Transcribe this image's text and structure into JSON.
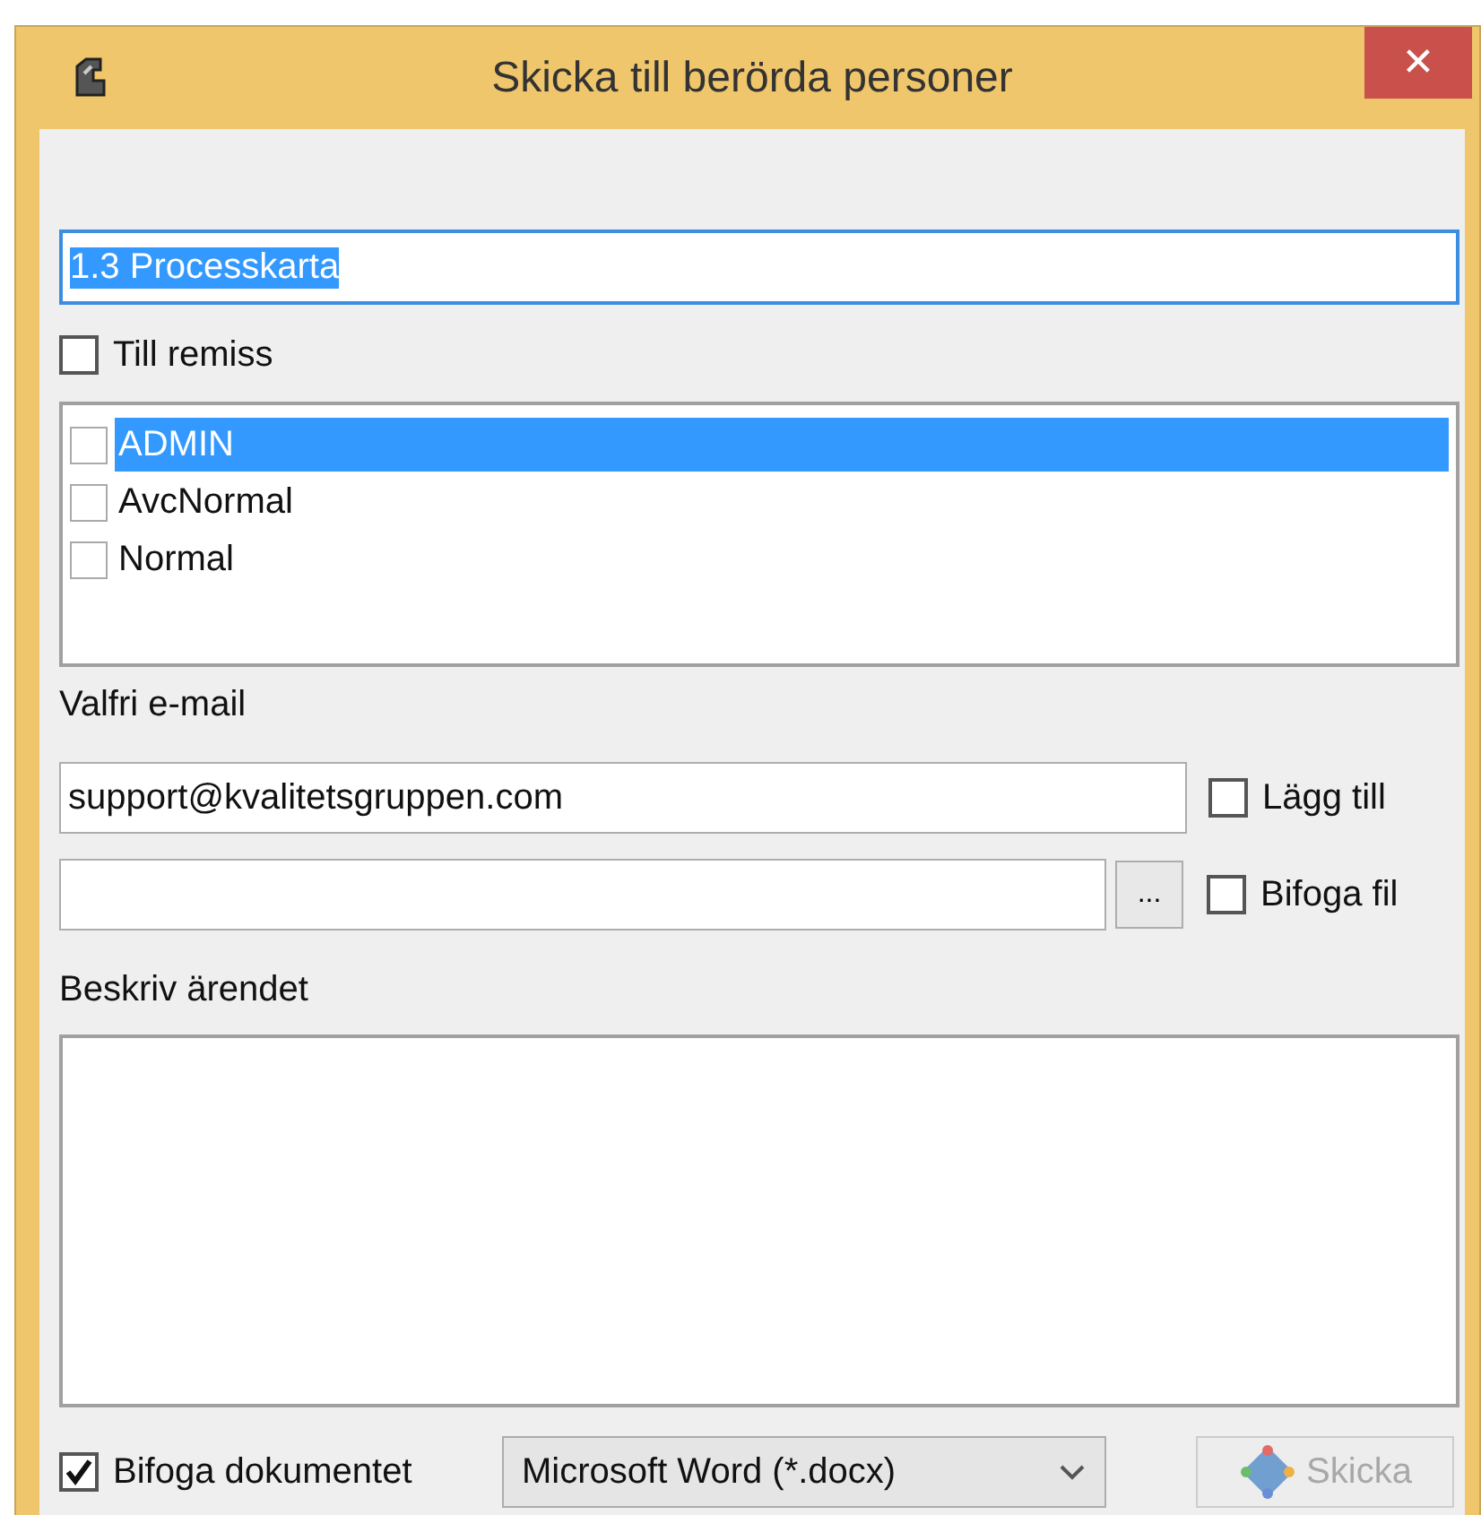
{
  "window": {
    "title": "Skicka till berörda personer",
    "close_label": "✕"
  },
  "subject_field": {
    "value": "1.3 Processkarta",
    "text_selected": true
  },
  "till_remiss": {
    "label": "Till remiss",
    "checked": false
  },
  "recipients": [
    {
      "label": "ADMIN",
      "checked": false,
      "selected": true
    },
    {
      "label": "AvcNormal",
      "checked": false,
      "selected": false
    },
    {
      "label": "Normal",
      "checked": false,
      "selected": false
    }
  ],
  "email_label": "Valfri e-mail",
  "email_field": {
    "value": "support@kvalitetsgruppen.com"
  },
  "lagg_till": {
    "label": "Lägg till",
    "checked": false
  },
  "browse_button": "...",
  "bifoga_fil": {
    "label": "Bifoga fil",
    "checked": false
  },
  "description_label": "Beskriv ärendet",
  "attach_document": {
    "label": "Bifoga dokumentet",
    "checked": true
  },
  "format_dropdown": {
    "value": "Microsoft Word (*.docx)"
  },
  "send_button": {
    "label": "Skicka",
    "disabled": true
  }
}
